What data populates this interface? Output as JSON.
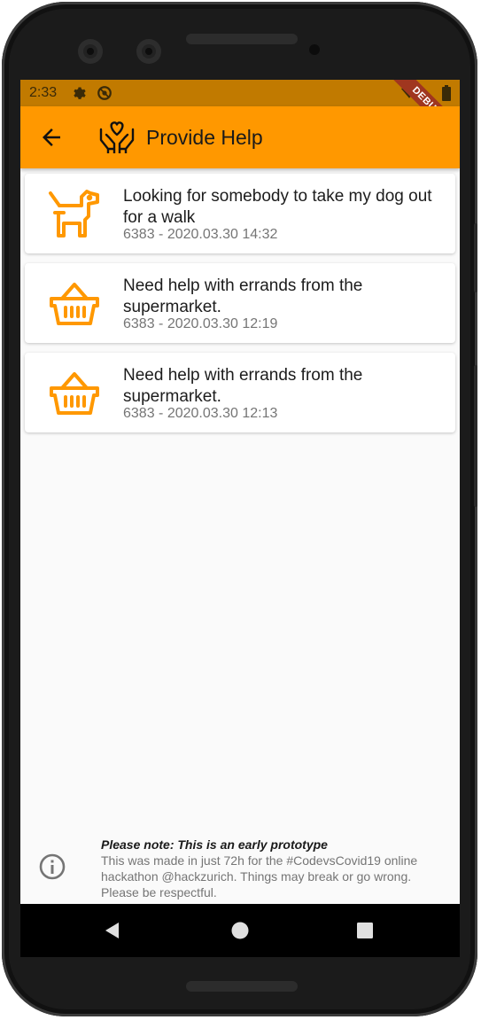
{
  "status_bar": {
    "time": "2:33",
    "debug_label": "DEBUG"
  },
  "app_bar": {
    "title": "Provide Help",
    "accent_color": "#ff9800"
  },
  "requests": [
    {
      "icon": "dog-icon",
      "title": "Looking for somebody to take my dog out for a walk",
      "meta": "6383 - 2020.03.30 14:32"
    },
    {
      "icon": "basket-icon",
      "title": "Need help with errands from the supermarket.",
      "meta": "6383 - 2020.03.30 12:19"
    },
    {
      "icon": "basket-icon",
      "title": "Need help with errands from the supermarket.",
      "meta": "6383 - 2020.03.30 12:13"
    }
  ],
  "footer": {
    "note_title": "Please note: This is an early prototype",
    "note_body": "This was made in just 72h for the #CodevsCovid19 online hackathon @hackzurich. Things may break or go wrong. Please be respectful."
  }
}
